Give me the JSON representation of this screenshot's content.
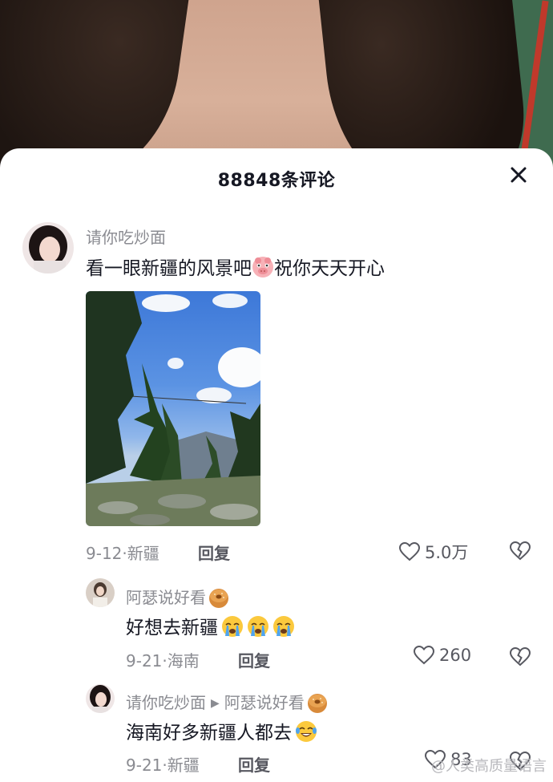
{
  "sheet": {
    "title": "88848条评论"
  },
  "comments": [
    {
      "username": "请你吃炒面",
      "text_before": "看一眼新疆的风景吧",
      "emoji_mid": "pig-face-emoji",
      "text_after": "祝你天天开心",
      "date": "9-12·",
      "location": "新疆",
      "reply_label": "回复",
      "likes": "5.0万"
    }
  ],
  "replies": [
    {
      "username": "阿瑟说好看",
      "name_emoji": "bagel-emoji",
      "text": "好想去新疆",
      "emojis": [
        "crying-face-emoji",
        "crying-face-emoji",
        "crying-face-emoji"
      ],
      "date": "9-21·",
      "location": "海南",
      "reply_label": "回复",
      "likes": "260"
    },
    {
      "username": "请你吃炒面",
      "reply_to": "阿瑟说好看",
      "name_emoji": "bagel-emoji",
      "text": "海南好多新疆人都去",
      "emojis": [
        "tears-of-joy-emoji"
      ],
      "date": "9-21·",
      "location": "新疆",
      "reply_label": "回复",
      "likes": "83"
    }
  ],
  "watermark": "@人类高质量语言",
  "colors": {
    "primary_text": "#161823",
    "secondary_text": "#8a8b91",
    "accent_icon": "#575860"
  }
}
